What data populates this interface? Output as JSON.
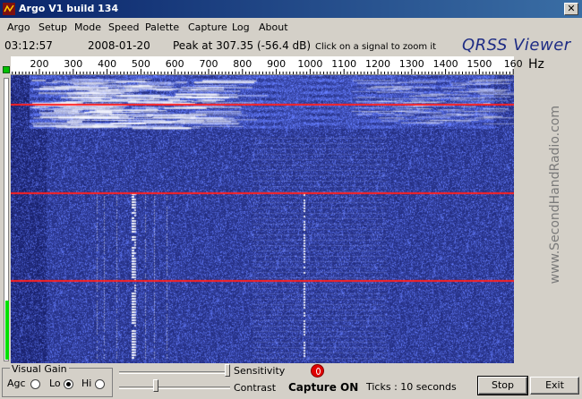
{
  "window": {
    "title": "Argo V1 build 134",
    "close_glyph": "✕"
  },
  "menu": [
    "Argo",
    "Setup",
    "Mode",
    "Speed",
    "Palette",
    "Capture",
    "Log",
    "About"
  ],
  "status": {
    "time": "03:12:57",
    "date": "2008-01-20",
    "peak": "Peak at  307.35 (-56.4 dB)",
    "hint": "Click on a signal to zoom it"
  },
  "brand": "QRSS Viewer",
  "watermark": "www.SecondHandRadio.com",
  "scale": {
    "labels": [
      "200",
      "300",
      "400",
      "500",
      "600",
      "700",
      "800",
      "900",
      "1000",
      "1100",
      "1200",
      "1300",
      "1400",
      "1500",
      "160"
    ],
    "unit": "Hz"
  },
  "level_meter": 0.21,
  "visual_gain": {
    "title": "Visual Gain",
    "agc": "Agc",
    "lo": "Lo",
    "hi": "Hi",
    "selected": "lo"
  },
  "sliders": {
    "sensitivity": "Sensitivity",
    "contrast": "Contrast",
    "sensitivity_value": 1.0,
    "contrast_value": 0.32
  },
  "capture": {
    "status": "Capture ON"
  },
  "ticks": {
    "text": "Ticks  : 10 seconds"
  },
  "buttons": {
    "stop": "Stop",
    "exit": "Exit"
  },
  "colors": {
    "waterfall_bg": "#0b0f4f",
    "marker": "#ff2020",
    "title_bar": "#0a246a"
  }
}
